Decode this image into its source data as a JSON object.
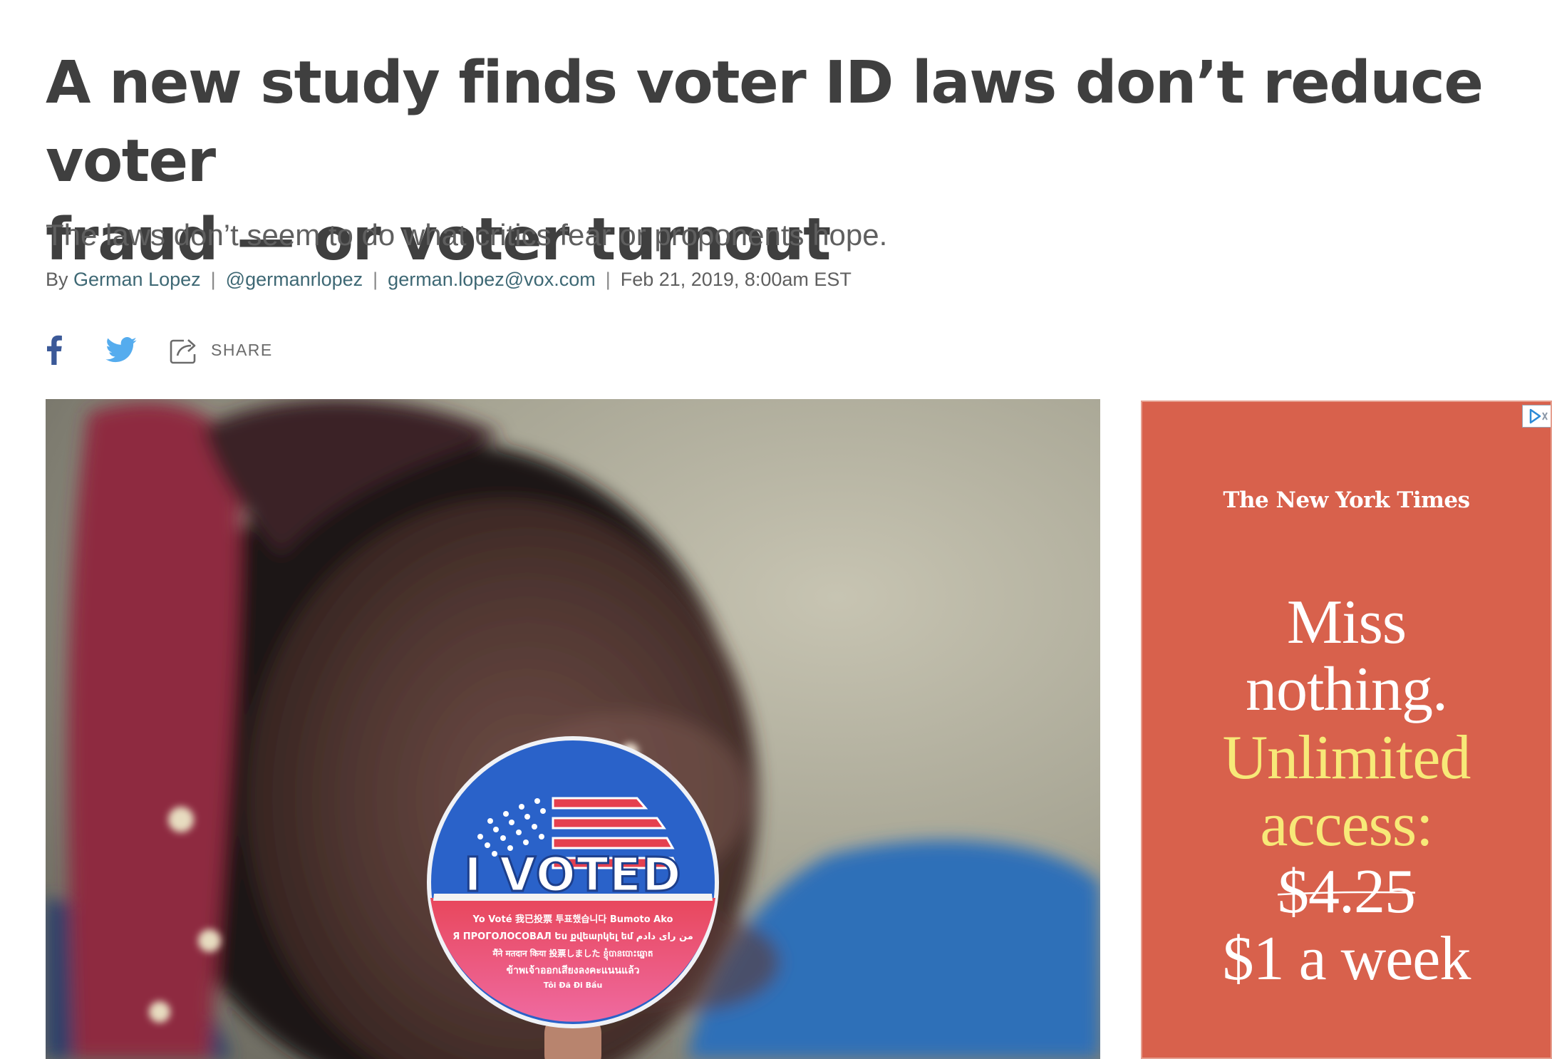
{
  "article": {
    "headline_line1": "A new study finds voter ID laws don’t reduce voter",
    "headline_line2": "fraud — or voter turnout",
    "dek": "The laws don’t seem to do what critics fear or proponents hope.",
    "byline": {
      "by": "By",
      "author": "German Lopez",
      "handle": "@germanrlopez",
      "email": "german.lopez@vox.com",
      "date": "Feb 21, 2019, 8:00am EST"
    },
    "share": {
      "label": "SHARE",
      "icons": [
        "facebook-icon",
        "twitter-icon",
        "share-icon"
      ],
      "facebook_color": "#3b5998",
      "twitter_color": "#55acee"
    },
    "hero_sticker": {
      "title": "I VOTED",
      "lines": [
        "Yo Voté   我已投票   투표했습니다   Bumoto Ako",
        "Я ПРОГОЛОСОВАЛ   Ես քվեարկել եմ   من رای دادم",
        "मैंने मतदान किया   投票しました   ខ្ញុំបានបោះឆ្នោត",
        "ข้าพเจ้าออกเสียงลงคะแนนแล้ว",
        "Tôi Đã Đi Bầu"
      ]
    }
  },
  "ad": {
    "brand": "The New York Times",
    "line1": "Miss",
    "line2": "nothing.",
    "line3": "Unlimited",
    "line4": "access:",
    "old_price": "$4.25",
    "new_price": "$1 a week",
    "background": "#d8614c",
    "highlight": "#f7e978"
  }
}
